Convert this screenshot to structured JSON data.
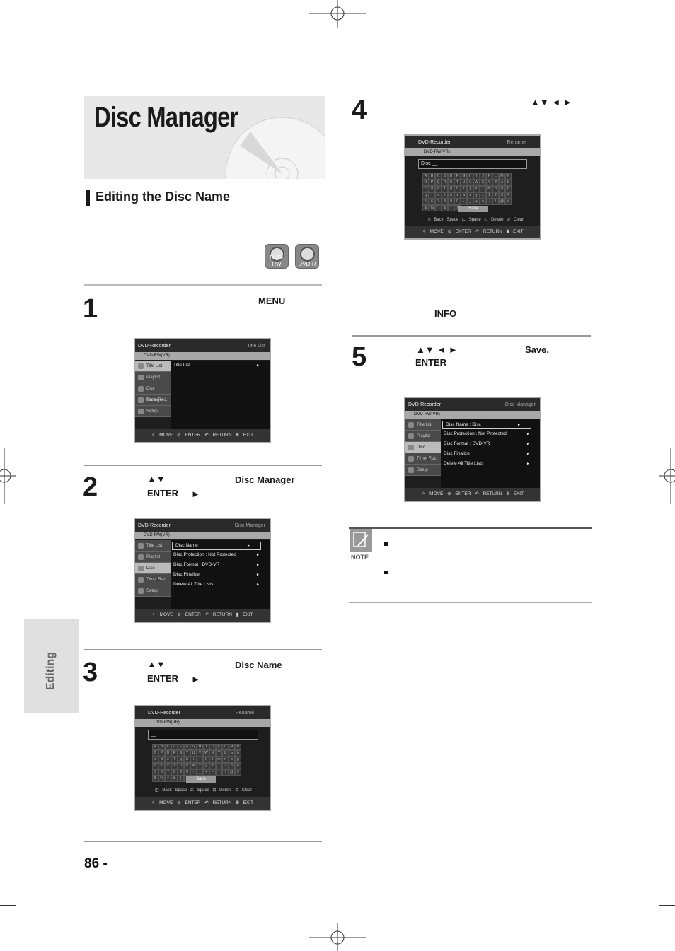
{
  "header": {
    "title": "Disc Manager"
  },
  "section": {
    "title": "Editing the Disc Name"
  },
  "badges": [
    "DVD-RW",
    "DVD-R"
  ],
  "side_tab": "Editing",
  "steps": [
    {
      "num": "1",
      "keys": [
        "MENU"
      ]
    },
    {
      "num": "2",
      "keys": [
        "▲▼",
        "Disc Manager",
        "ENTER",
        "►"
      ]
    },
    {
      "num": "3",
      "keys": [
        "▲▼",
        "Disc Name",
        "ENTER",
        "►"
      ]
    },
    {
      "num": "4",
      "keys": [
        "▲▼ ◄ ►",
        "INFO"
      ]
    },
    {
      "num": "5",
      "keys": [
        "▲▼ ◄ ►",
        "Save,",
        "ENTER"
      ]
    }
  ],
  "osd1": {
    "left": "DVD-Recorder",
    "right": "Title List",
    "sub": "DVD-RW(VR)",
    "side": [
      "Title List",
      "Playlist",
      "Disc Manager",
      "Timer Rec.",
      "Setup"
    ],
    "main": [
      "Title List"
    ],
    "footer": "✧ MOVE  ⊘ ENTER  ↶ RETURN  Ⅲ EXIT"
  },
  "osd2": {
    "left": "DVD-Recorder",
    "right": "Disc Manager",
    "sub": "DVD-RW(VR)",
    "side": [
      "Title List",
      "Playlist",
      "Disc Manager",
      "Timer Rec.",
      "Setup"
    ],
    "main": [
      "Disc Name :",
      "Disc Protection : Not Protected",
      "Disc Format : DVD-VR",
      "Disc Finalize",
      "Delete All Title Lists"
    ],
    "footer": "✧ MOVE  ⊘ ENTER  ↶ RETURN  ▮ EXIT"
  },
  "osd3": {
    "left": "DVD-Recorder",
    "right": "Rename",
    "sub": "DVD-RW(VR)",
    "field": "__",
    "save": "Save",
    "keys": "◫ Back Space  ⊏ Space  ⊡ Delete  ⊙ Clear",
    "footer": "✧ MOVE  ⊘ ENTER  ↶ RETURN  Ⅲ EXIT"
  },
  "osd4": {
    "left": "DVD-Recorder",
    "right": "Rename",
    "sub": "DVD-RW(VR)",
    "field": "Disc __",
    "save": "Save",
    "keys": "◫ Back Space  ⊏ Space  ⊡ Delete  ⊙ Clear",
    "footer": "✧ MOVE  ⊘ ENTER  ↶ RETURN  ▮ EXIT"
  },
  "osd5": {
    "left": "DVD-Recorder",
    "right": "Disc Manager",
    "sub": "DVD-RW(VR)",
    "side": [
      "Title List",
      "Playlist",
      "Disc Manager",
      "Timer Rec.",
      "Setup"
    ],
    "main": [
      "Disc Name : Disc",
      "Disc Protection : Not Protected",
      "Disc Format : DVD-VR",
      "Disc Finalize",
      "Delete All Title Lists"
    ],
    "footer": "✧ MOVE  ⊘ ENTER  ↶ RETURN  Ⅲ EXIT"
  },
  "keyboard": [
    "A",
    "B",
    "C",
    "D",
    "E",
    "F",
    "G",
    "H",
    "I",
    "J",
    "K",
    "L",
    "M",
    "N",
    "O",
    "P",
    "Q",
    "R",
    "S",
    "T",
    "U",
    "V",
    "W",
    "X",
    "Y",
    "Z",
    "a",
    "b",
    "c",
    "d",
    "e",
    "f",
    "g",
    "h",
    "i",
    "j",
    "k",
    "l",
    "m",
    "n",
    "o",
    "p",
    "q",
    "r",
    "s",
    "t",
    "u",
    "v",
    "w",
    "x",
    "y",
    "z",
    "1",
    "2",
    "3",
    "4",
    "5",
    "6",
    "7",
    "8",
    "9",
    "0",
    "-",
    "_",
    "+",
    "=",
    "-",
    "!",
    "@",
    "#",
    "$",
    "%",
    "^",
    "&",
    "(",
    ")"
  ],
  "note": {
    "label": "NOTE"
  },
  "page": {
    "number": "86 -"
  }
}
